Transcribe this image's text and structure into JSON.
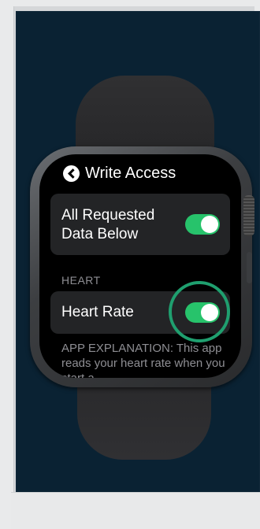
{
  "screen": {
    "title": "Write Access",
    "all_requested": {
      "label": "All Requested Data Below",
      "state": "on"
    },
    "section_heading": "HEART",
    "heart_rate": {
      "label": "Heart Rate",
      "state": "on"
    },
    "explanation": "APP EXPLANATION: This app reads your heart rate when you start a"
  },
  "colors": {
    "toggle_on": "#27c36b",
    "highlight_ring": "#1f9f6f",
    "background_panel": "#0a2233"
  },
  "icons": {
    "back": "chevron-left-icon"
  }
}
